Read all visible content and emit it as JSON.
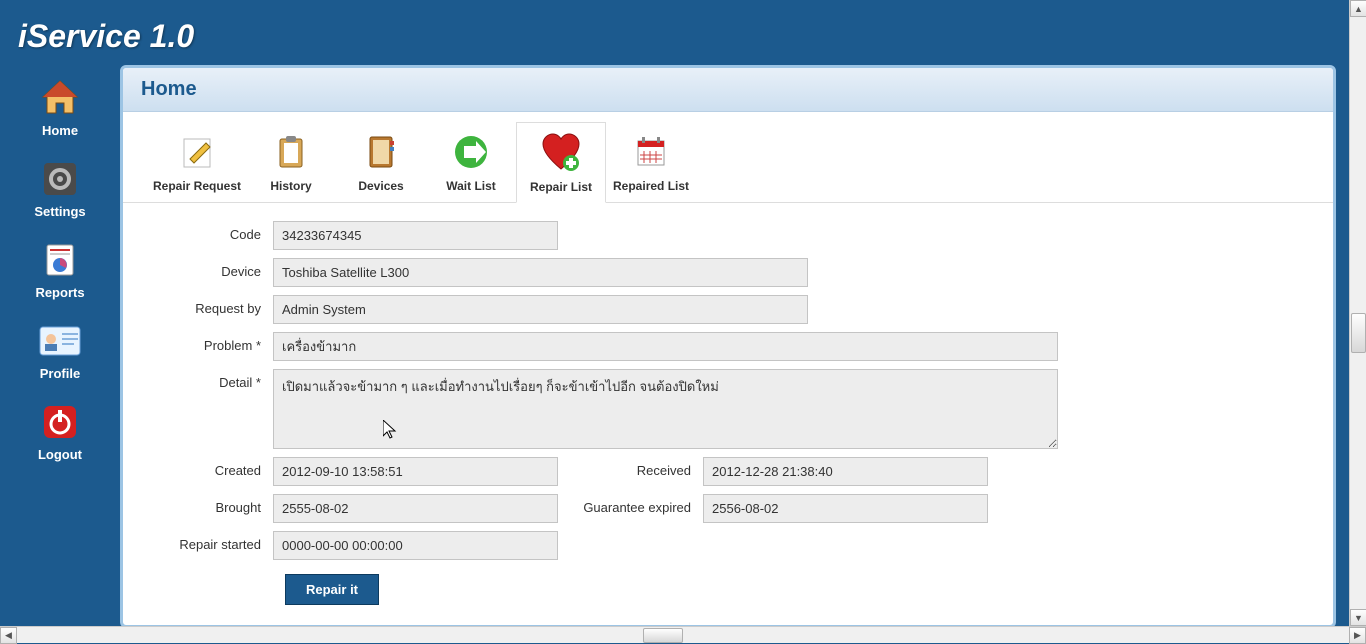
{
  "app": {
    "title": "iService 1.0"
  },
  "sidebar": {
    "items": [
      {
        "label": "Home"
      },
      {
        "label": "Settings"
      },
      {
        "label": "Reports"
      },
      {
        "label": "Profile"
      },
      {
        "label": "Logout"
      }
    ]
  },
  "panel": {
    "title": "Home"
  },
  "toolbar": {
    "items": [
      {
        "label": "Repair Request"
      },
      {
        "label": "History"
      },
      {
        "label": "Devices"
      },
      {
        "label": "Wait List"
      },
      {
        "label": "Repair List"
      },
      {
        "label": "Repaired List"
      }
    ],
    "active_index": 4
  },
  "form": {
    "labels": {
      "code": "Code",
      "device": "Device",
      "request_by": "Request by",
      "problem": "Problem *",
      "detail": "Detail *",
      "created": "Created",
      "received": "Received",
      "brought": "Brought",
      "guarantee": "Guarantee expired",
      "repair_started": "Repair started"
    },
    "values": {
      "code": "34233674345",
      "device": "Toshiba Satellite L300",
      "request_by": "Admin System",
      "problem": "เครื่องข้ามาก",
      "detail": "เปิดมาแล้วจะข้ามาก ๆ และเมื่อทำงานไปเรื่อยๆ ก็จะข้าเข้าไปอีก จนต้องปิดใหม่",
      "created": "2012-09-10 13:58:51",
      "received": "2012-12-28 21:38:40",
      "brought": "2555-08-02",
      "guarantee": "2556-08-02",
      "repair_started": "0000-00-00 00:00:00"
    },
    "submit_label": "Repair it"
  }
}
